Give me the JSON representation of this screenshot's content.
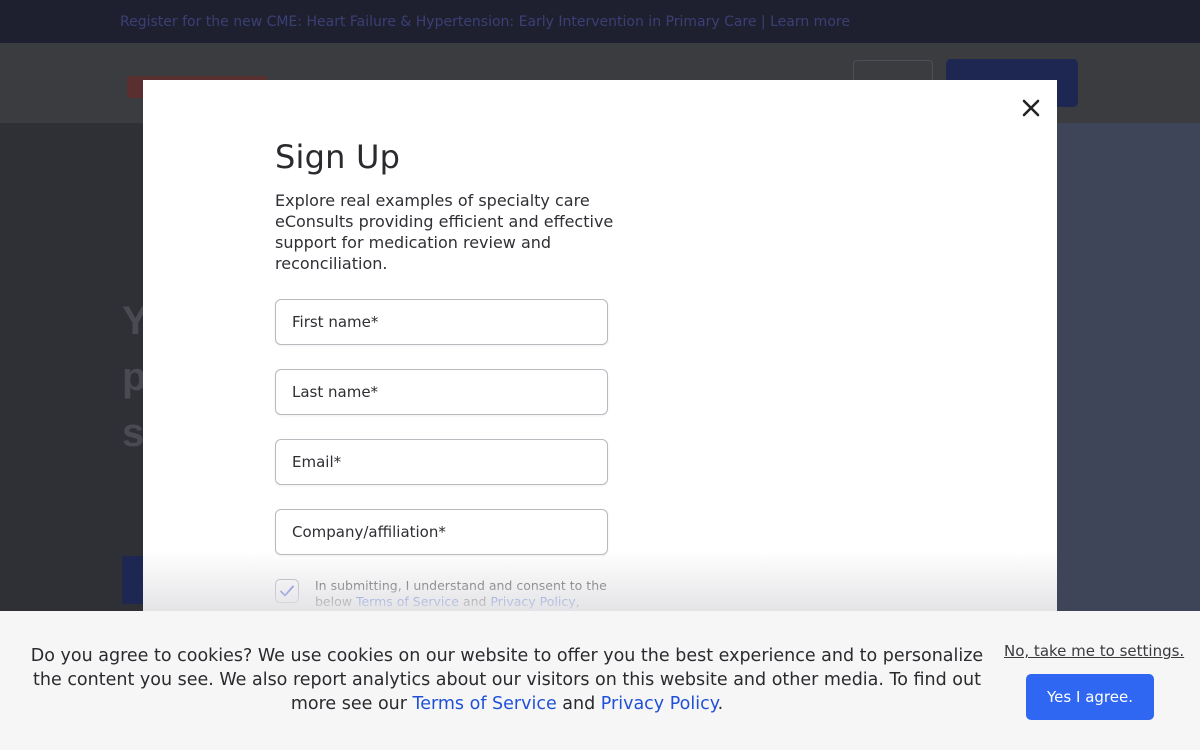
{
  "background": {
    "announcement": "Register for the new CME: Heart Failure & Hypertension: Early Intervention in Primary Care  |  Learn more",
    "hero_heading_fragment": [
      "Y",
      "p",
      "s"
    ]
  },
  "modal": {
    "title": "Sign Up",
    "description": "Explore real examples of specialty care eConsults providing efficient and effective support for medication review and reconciliation.",
    "fields": {
      "first_name_placeholder": "First name*",
      "last_name_placeholder": "Last name*",
      "email_placeholder": "Email*",
      "company_placeholder": "Company/affiliation*"
    },
    "consent": {
      "checked": true,
      "text_before": "In submitting, I understand and consent to the below ",
      "terms_link": "Terms of Service",
      "text_and": " and ",
      "privacy_link": "Privacy Policy",
      "text_after": ", which"
    }
  },
  "cookie_banner": {
    "text_before": "Do you agree to cookies? We use cookies on our website to offer you the best experience and to personalize the content you see. We also report analytics about our visitors on this website and other media. To find out more see our ",
    "terms_link": "Terms of Service",
    "text_and": " and ",
    "privacy_link": "Privacy Policy",
    "text_after": ".",
    "settings_link": "No, take me to settings.",
    "agree_button": "Yes I agree."
  },
  "colors": {
    "accent": "#2f66f2",
    "link": "#2050d8",
    "check": "#3a5bd8"
  },
  "icons": {
    "close": "close-icon",
    "checkbox": "checkmark-icon"
  }
}
